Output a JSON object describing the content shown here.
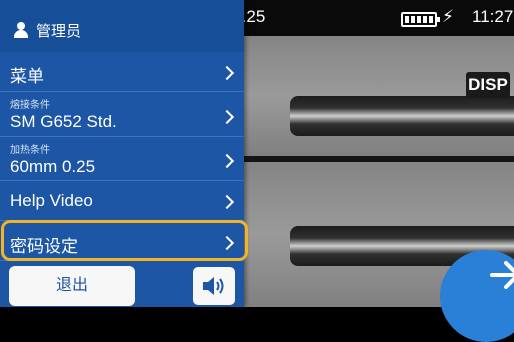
{
  "status_bar": {
    "version_fragment": ").25",
    "time": "11:27"
  },
  "display_button": {
    "label": "DISP"
  },
  "side_menu": {
    "user": {
      "name": "管理员"
    },
    "items": [
      {
        "label": "菜单"
      },
      {
        "sublabel": "熔接条件",
        "label": "SM G652 Std."
      },
      {
        "sublabel": "加热条件",
        "label": "60mm 0.25"
      },
      {
        "label": "Help Video"
      },
      {
        "label": "密码设定",
        "highlighted": true
      }
    ],
    "logout_label": "退出"
  },
  "colors": {
    "panel": "#1c56a4",
    "highlight": "#f2b424",
    "fab": "#2a7fd6"
  }
}
